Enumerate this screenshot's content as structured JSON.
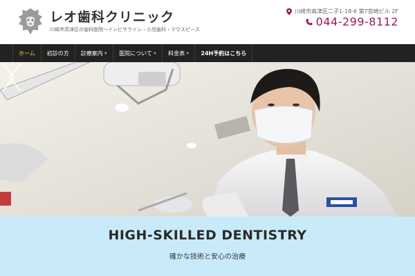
{
  "header": {
    "title": "レオ歯科クリニック",
    "subtitle": "川崎市高津区の歯科医院〜インビザライン・小児歯科・マウスピース",
    "address": "川崎市高津区二子1-18-6 第7宮崎ビル 2F",
    "phone": "044-299-8112"
  },
  "nav": {
    "items": [
      {
        "label": "ホーム",
        "active": true,
        "has_arrow": false
      },
      {
        "label": "初診の方",
        "active": false,
        "has_arrow": false
      },
      {
        "label": "診療案内",
        "active": false,
        "has_arrow": true
      },
      {
        "label": "医院について",
        "active": false,
        "has_arrow": true
      },
      {
        "label": "料金表",
        "active": false,
        "has_arrow": true
      },
      {
        "label": "24H予約はこちら",
        "active": false,
        "has_arrow": false
      }
    ]
  },
  "hero": {
    "caption_title": "HIGH-SKILLED DENTISTRY",
    "caption_sub": "確かな技術と安心の治療"
  },
  "colors": {
    "phone": "#9b1a5c",
    "nav_bg": "#222222",
    "nav_active": "#e8c93a",
    "caption_bg": "#c9ebf9"
  },
  "icons": {
    "logo": "lion-head-logo",
    "address": "map-pin-icon",
    "phone": "phone-icon",
    "prev": "chevron-left-icon",
    "next": "chevron-right-icon"
  }
}
